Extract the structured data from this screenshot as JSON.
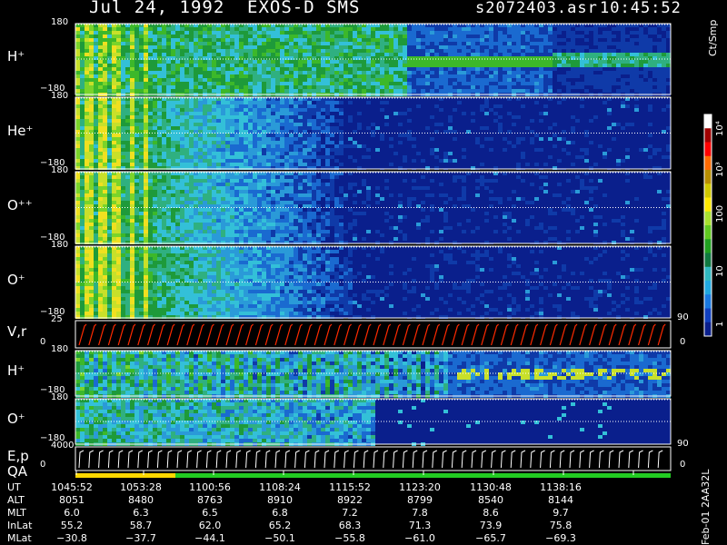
{
  "header": {
    "date": "Jul 24, 1992",
    "title": "EXOS-D SMS",
    "file": "s2072403.asr",
    "time": "10:45:52"
  },
  "colorbar": {
    "unit": "Ct/Smp",
    "ticks": [
      "10⁴",
      "10³",
      "100",
      "10",
      "1"
    ]
  },
  "panels": [
    {
      "label": "H⁺",
      "ymax": "180",
      "ymin": "−180"
    },
    {
      "label": "He⁺",
      "ymax": "180",
      "ymin": "−180"
    },
    {
      "label": "O⁺⁺",
      "ymax": "180",
      "ymin": "−180"
    },
    {
      "label": "O⁺",
      "ymax": "180",
      "ymin": "−180"
    },
    {
      "label": "V,r",
      "ymax": "25",
      "ymin": "0",
      "right_top": "90",
      "right_bottom": "0"
    },
    {
      "label": "H⁺",
      "ymax": "180",
      "ymin": "−180"
    },
    {
      "label": "O⁺",
      "ymax": "180",
      "ymin": "−180"
    },
    {
      "label": "E,p",
      "ymax": "4000",
      "ymin": "0",
      "right_top": "90",
      "right_bottom": "0"
    }
  ],
  "qa_label": "QA",
  "table": {
    "rows": [
      {
        "name": "UT",
        "values": [
          "1045:52",
          "1053:28",
          "1100:56",
          "1108:24",
          "1115:52",
          "1123:20",
          "1130:48",
          "1138:16"
        ]
      },
      {
        "name": "ALT",
        "values": [
          "8051",
          "8480",
          "8763",
          "8910",
          "8922",
          "8799",
          "8540",
          "8144"
        ]
      },
      {
        "name": "MLT",
        "values": [
          "6.0",
          "6.3",
          "6.5",
          "6.8",
          "7.2",
          "7.8",
          "8.6",
          "9.7"
        ]
      },
      {
        "name": "InLat",
        "values": [
          "55.2",
          "58.7",
          "62.0",
          "65.2",
          "68.3",
          "71.3",
          "73.9",
          "75.8"
        ]
      },
      {
        "name": "MLat",
        "values": [
          "−30.8",
          "−37.7",
          "−44.1",
          "−50.1",
          "−55.8",
          "−61.0",
          "−65.7",
          "−69.3"
        ]
      }
    ]
  },
  "footer_note": "Feb-01 2AA32L",
  "colors": {
    "background": "#000000",
    "plot_bg": "#0a1f8c",
    "qa_yellow": "#ffd800",
    "qa_green": "#22cc22",
    "line_red": "#ff2a00"
  },
  "chart_data": {
    "type": "heatmap",
    "title": "Jul 24, 1992 EXOS-D SMS",
    "x_ticks": [
      "1045:52",
      "1053:28",
      "1100:56",
      "1108:24",
      "1115:52",
      "1123:20",
      "1130:48",
      "1138:16"
    ],
    "series": [
      {
        "name": "H⁺",
        "ylim": [
          -180,
          180
        ]
      },
      {
        "name": "He⁺",
        "ylim": [
          -180,
          180
        ]
      },
      {
        "name": "O⁺⁺",
        "ylim": [
          -180,
          180
        ]
      },
      {
        "name": "O⁺",
        "ylim": [
          -180,
          180
        ]
      },
      {
        "name": "V,r",
        "ylim": [
          0,
          25
        ]
      },
      {
        "name": "H⁺",
        "ylim": [
          -180,
          180
        ]
      },
      {
        "name": "O⁺",
        "ylim": [
          -180,
          180
        ]
      },
      {
        "name": "E,p",
        "ylim": [
          0,
          4000
        ]
      }
    ],
    "colorscale_unit": "Ct/Smp",
    "colorscale_range": [
      1,
      10000
    ],
    "colorscale_log": true
  }
}
